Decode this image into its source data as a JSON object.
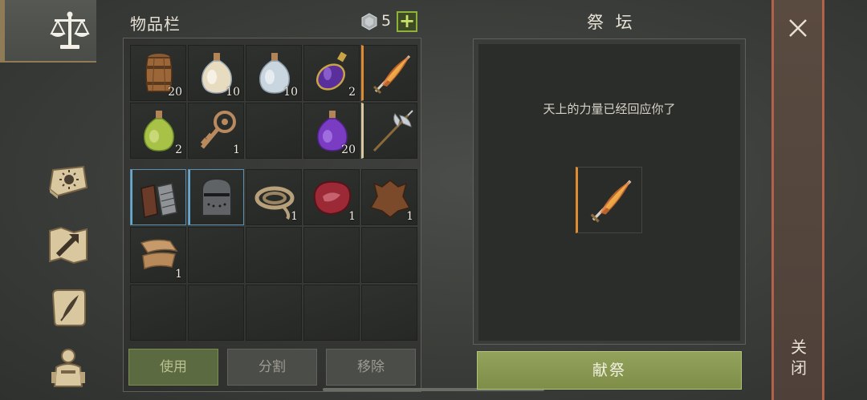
{
  "inventory": {
    "title": "物品栏",
    "gem_count": "5",
    "plus_label": "+",
    "row1": [
      {
        "name": "barrel",
        "qty": "20"
      },
      {
        "name": "potion-white",
        "qty": "10"
      },
      {
        "name": "potion-clear",
        "qty": "10"
      },
      {
        "name": "potion-purple-ornate",
        "qty": "2"
      },
      {
        "name": "flaming-sword",
        "qty": ""
      }
    ],
    "row2": [
      {
        "name": "potion-green",
        "qty": "2"
      },
      {
        "name": "ornate-key",
        "qty": "1"
      },
      {
        "name": "empty",
        "qty": ""
      },
      {
        "name": "potion-purple",
        "qty": "20"
      },
      {
        "name": "halberd",
        "qty": ""
      }
    ],
    "row3": [
      {
        "name": "gauntlets",
        "qty": ""
      },
      {
        "name": "helmet",
        "qty": ""
      },
      {
        "name": "rope",
        "qty": "1"
      },
      {
        "name": "raw-meat",
        "qty": "1"
      },
      {
        "name": "leather-hide",
        "qty": "1"
      }
    ],
    "row4": [
      {
        "name": "cloth",
        "qty": "1"
      }
    ]
  },
  "actions": {
    "use": "使用",
    "split": "分割",
    "remove": "移除"
  },
  "altar": {
    "title": "祭 坛",
    "message": "天上的力量已经回应你了",
    "offer": "献祭"
  },
  "close": {
    "label": "关闭"
  },
  "colors": {
    "accent_orange": "#e08a32",
    "equipped_blue": "#6aa8d0",
    "offer_green": "#8b9b53",
    "close_border": "#b4614a"
  }
}
